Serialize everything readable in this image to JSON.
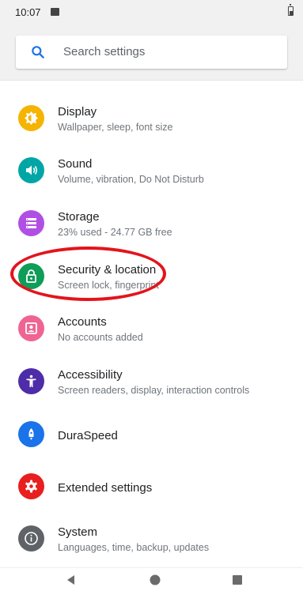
{
  "status_bar": {
    "time": "10:07",
    "notification_icon": "image-icon",
    "battery_icon": "battery-icon"
  },
  "search": {
    "placeholder": "Search settings",
    "icon": "search-icon",
    "accent_color": "#1a73e8"
  },
  "settings": [
    {
      "id": "display",
      "title": "Display",
      "summary": "Wallpaper, sleep, font size",
      "icon": "brightness-icon",
      "color": "#f5b400"
    },
    {
      "id": "sound",
      "title": "Sound",
      "summary": "Volume, vibration, Do Not Disturb",
      "icon": "volume-icon",
      "color": "#00a6a6"
    },
    {
      "id": "storage",
      "title": "Storage",
      "summary": "23% used - 24.77 GB free",
      "icon": "storage-icon",
      "color": "#b14fe4"
    },
    {
      "id": "security",
      "title": "Security & location",
      "summary": "Screen lock, fingerprint",
      "icon": "lock-icon",
      "color": "#0f9d58"
    },
    {
      "id": "accounts",
      "title": "Accounts",
      "summary": "No accounts added",
      "icon": "account-icon",
      "color": "#ef6493"
    },
    {
      "id": "accessibility",
      "title": "Accessibility",
      "summary": "Screen readers, display, interaction controls",
      "icon": "accessibility-icon",
      "color": "#4d2da8"
    },
    {
      "id": "duraspeed",
      "title": "DuraSpeed",
      "summary": "",
      "icon": "rocket-icon",
      "color": "#1a73e8"
    },
    {
      "id": "extended",
      "title": "Extended settings",
      "summary": "",
      "icon": "gear-icon",
      "color": "#e91e1e"
    },
    {
      "id": "system",
      "title": "System",
      "summary": "Languages, time, backup, updates",
      "icon": "info-icon",
      "color": "#5f6368"
    }
  ],
  "annotation": {
    "color": "#e3141d",
    "target": "security"
  },
  "nav_bar": {
    "back_icon": "back-icon",
    "home_icon": "home-icon",
    "recents_icon": "recents-icon"
  }
}
